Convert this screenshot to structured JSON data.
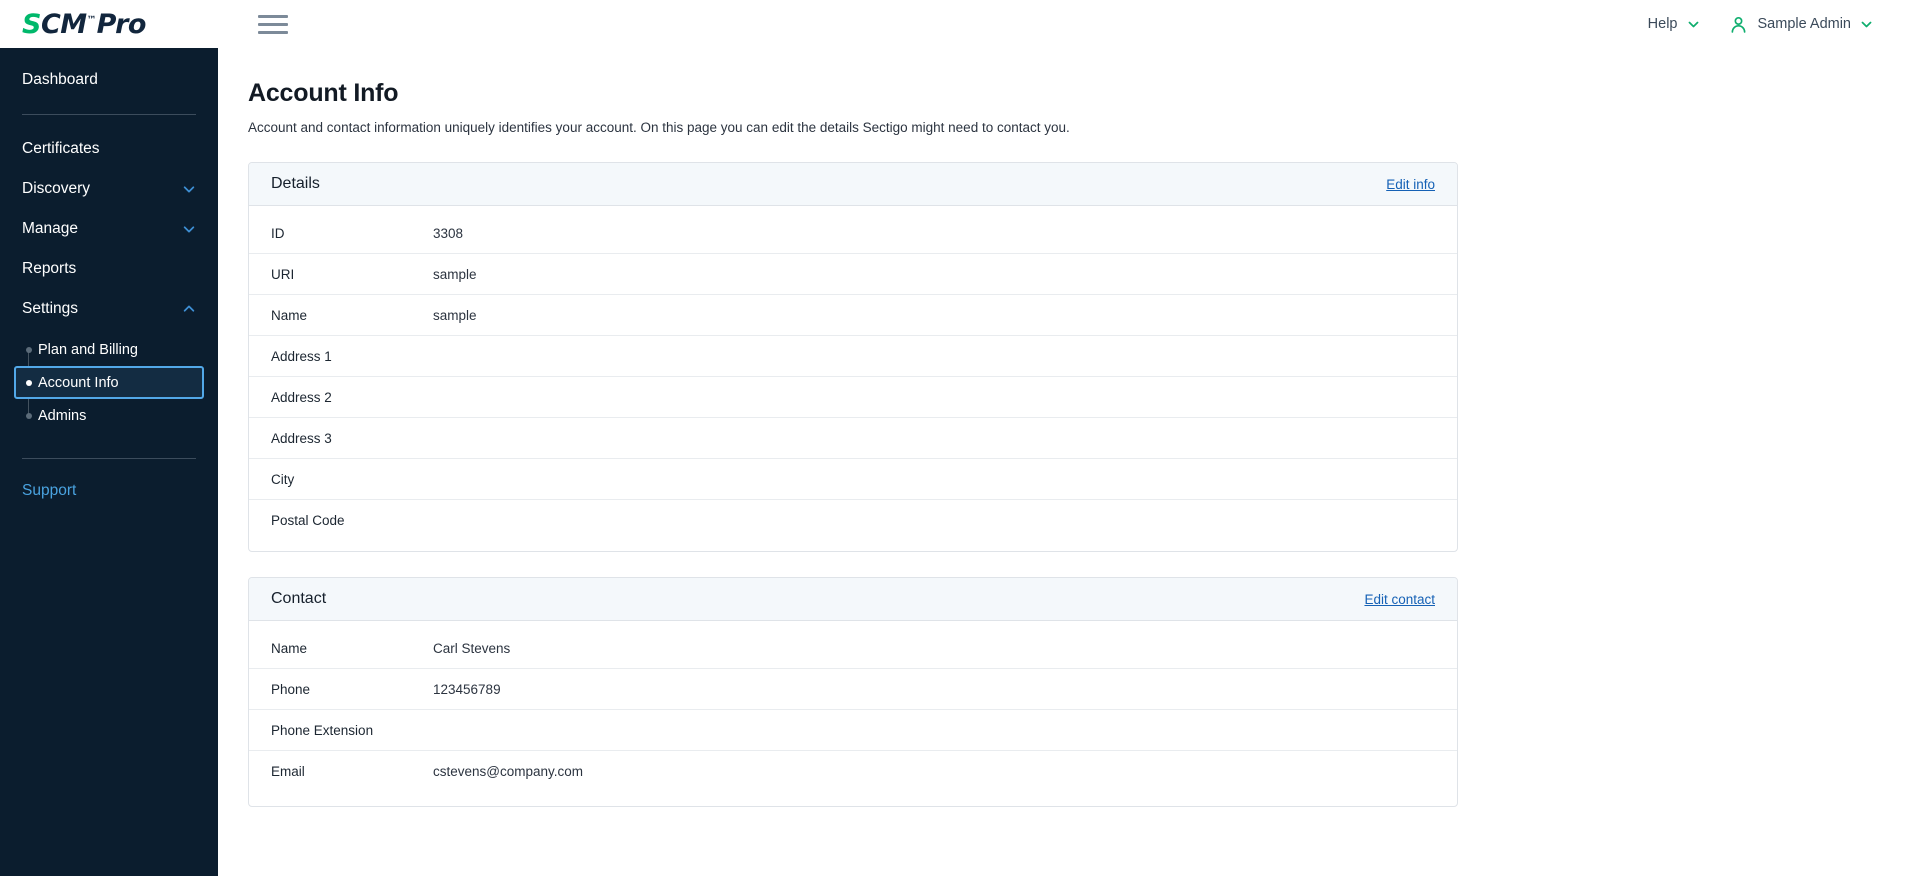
{
  "brand": {
    "logo_prefix": "S",
    "logo_mid": "CM",
    "logo_tm": "™",
    "logo_suffix": "Pro"
  },
  "topbar": {
    "help_label": "Help",
    "user_label": "Sample Admin",
    "menu_icon": "hamburger-icon",
    "help_chevron_icon": "chevron-down-icon",
    "user_icon": "person-icon",
    "user_chevron_icon": "chevron-down-icon",
    "accent_color": "#00b86b"
  },
  "sidebar": {
    "background": "#0b1d2e",
    "accent_selected": "#52a8e8",
    "dashboard": {
      "label": "Dashboard"
    },
    "items": [
      {
        "label": "Certificates",
        "has_caret": false,
        "caret": ""
      },
      {
        "label": "Discovery",
        "has_caret": true,
        "caret": "chevron-down-icon"
      },
      {
        "label": "Manage",
        "has_caret": true,
        "caret": "chevron-down-icon"
      },
      {
        "label": "Reports",
        "has_caret": false,
        "caret": ""
      },
      {
        "label": "Settings",
        "has_caret": true,
        "caret": "chevron-up-icon"
      }
    ],
    "subitems": [
      {
        "label": "Plan and Billing",
        "active": false
      },
      {
        "label": "Account Info",
        "active": true
      },
      {
        "label": "Admins",
        "active": false
      }
    ],
    "support": {
      "label": "Support",
      "color": "#4aa3e0"
    }
  },
  "page": {
    "title": "Account Info",
    "description": "Account and contact information uniquely identifies your account. On this page you can edit the details Sectigo might need to contact you."
  },
  "details_card": {
    "title": "Details",
    "action_label": "Edit info",
    "rows": [
      {
        "label": "ID",
        "value": "3308"
      },
      {
        "label": "URI",
        "value": "sample"
      },
      {
        "label": "Name",
        "value": "sample"
      },
      {
        "label": "Address 1",
        "value": ""
      },
      {
        "label": "Address 2",
        "value": ""
      },
      {
        "label": "Address 3",
        "value": ""
      },
      {
        "label": "City",
        "value": ""
      },
      {
        "label": "Postal Code",
        "value": ""
      }
    ]
  },
  "contact_card": {
    "title": "Contact",
    "action_label": "Edit contact",
    "rows": [
      {
        "label": "Name",
        "value": "Carl Stevens"
      },
      {
        "label": "Phone",
        "value": "123456789"
      },
      {
        "label": "Phone Extension",
        "value": ""
      },
      {
        "label": "Email",
        "value": "cstevens@company.com"
      }
    ]
  }
}
